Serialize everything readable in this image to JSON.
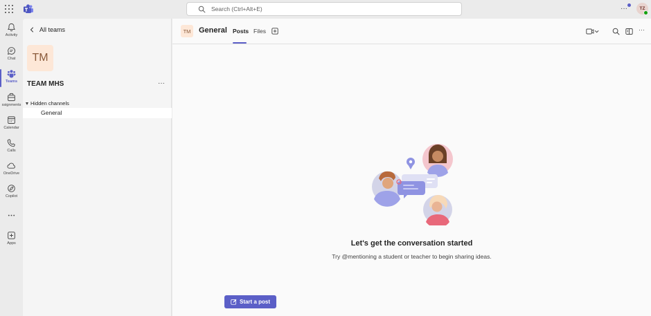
{
  "topbar": {
    "search_placeholder": "Search (Ctrl+Alt+E)",
    "more_label": "···",
    "user_initials": "TZ"
  },
  "rail": {
    "items": [
      {
        "label": "Activity",
        "icon": "bell-icon"
      },
      {
        "label": "Chat",
        "icon": "chat-icon"
      },
      {
        "label": "Teams",
        "icon": "teams-icon",
        "active": true
      },
      {
        "label": "ssignments",
        "icon": "assignments-icon"
      },
      {
        "label": "Calendar",
        "icon": "calendar-icon"
      },
      {
        "label": "Calls",
        "icon": "phone-icon"
      },
      {
        "label": "OneDrive",
        "icon": "cloud-icon"
      },
      {
        "label": "Copilot",
        "icon": "copilot-icon"
      },
      {
        "label": "",
        "icon": "more-icon"
      },
      {
        "label": "Apps",
        "icon": "apps-icon"
      }
    ]
  },
  "panel": {
    "back_label": "All teams",
    "team_initials": "TM",
    "team_name": "TEAM MHS",
    "more_label": "···",
    "hidden_channels_label": "Hidden channels",
    "channels": [
      {
        "name": "General",
        "selected": true
      }
    ]
  },
  "main": {
    "channel_initials": "TM",
    "channel_name": "General",
    "tabs": [
      {
        "label": "Posts",
        "active": true
      },
      {
        "label": "Files",
        "active": false
      }
    ],
    "more_label": "···",
    "empty_title": "Let's get the conversation started",
    "empty_subtitle": "Try @mentioning a student or teacher to begin sharing ideas.",
    "start_post_label": "Start a post"
  },
  "colors": {
    "accent": "#5b5fc7",
    "panel_bg": "#f5f5f5",
    "main_bg": "#fafafa",
    "rail_bg": "#ebebeb",
    "presence": "#13a10e"
  }
}
